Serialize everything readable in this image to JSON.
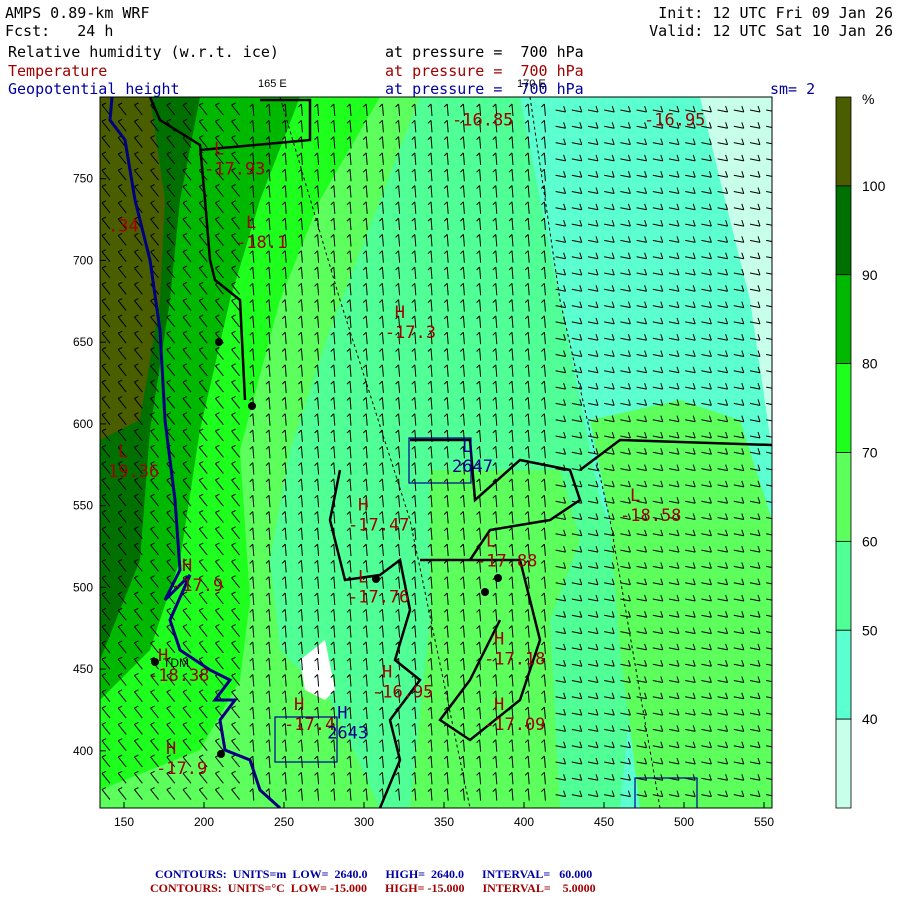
{
  "header": {
    "model": "AMPS 0.89-km WRF",
    "forecast": "Fcst:   24 h",
    "init": "Init: 12 UTC Fri 09 Jan 26",
    "valid": "Valid: 12 UTC Sat 10 Jan 26",
    "fields": [
      {
        "name": "Relative humidity (w.r.t. ice)",
        "level": "at pressure =  700 hPa"
      },
      {
        "name": "Temperature",
        "level": "at pressure =  700 hPa"
      },
      {
        "name": "Geopotential height",
        "level": "at pressure =  700 hPa"
      }
    ],
    "smoothing": "sm= 2",
    "lon_labels": [
      "165 E",
      "170 E"
    ]
  },
  "colors": {
    "temperature": "#a00000",
    "height": "#000090",
    "coast": "#000000",
    "river": "#000080"
  },
  "chart_data": {
    "type": "heatmap",
    "title": "Relative humidity (w.r.t. ice) at 700 hPa",
    "x_ticks": [
      "150",
      "200",
      "250",
      "300",
      "350",
      "400",
      "450",
      "500",
      "550"
    ],
    "y_ticks": [
      "750",
      "700",
      "650",
      "600",
      "550",
      "500",
      "450",
      "400"
    ],
    "xlim": [
      135,
      555
    ],
    "ylim": [
      365,
      800
    ],
    "colorbar": {
      "unit": "%",
      "levels": [
        "40",
        "50",
        "60",
        "70",
        "80",
        "90",
        "100"
      ],
      "colors": [
        "#c8ffea",
        "#5cffd0",
        "#50ff96",
        "#5cff5c",
        "#1eff1e",
        "#00b800",
        "#007000",
        "#4a5e00"
      ]
    },
    "temperature_labels": [
      {
        "mark": "",
        "value": "-16.85",
        "x": 355,
        "y": 790
      },
      {
        "mark": "",
        "value": "-16.95",
        "x": 475,
        "y": 790
      },
      {
        "mark": "L",
        "value": "-17.93",
        "x": 200,
        "y": 760
      },
      {
        "mark": "",
        "value": ".34",
        "x": 140,
        "y": 725
      },
      {
        "mark": "L",
        "value": "-18.1",
        "x": 220,
        "y": 715
      },
      {
        "mark": "H",
        "value": "-17.3",
        "x": 313,
        "y": 660
      },
      {
        "mark": "L",
        "value": "19.36",
        "x": 140,
        "y": 575
      },
      {
        "mark": "H",
        "value": "-17.47",
        "x": 290,
        "y": 542
      },
      {
        "mark": "L",
        "value": "-18.58",
        "x": 460,
        "y": 548
      },
      {
        "mark": "L",
        "value": "-17.88",
        "x": 370,
        "y": 520
      },
      {
        "mark": "H",
        "value": "-17.9",
        "x": 180,
        "y": 505
      },
      {
        "mark": "L",
        "value": "-17.76",
        "x": 290,
        "y": 498
      },
      {
        "mark": "H",
        "value": "-17.18",
        "x": 375,
        "y": 460
      },
      {
        "mark": "H",
        "value": "-18.38",
        "x": 165,
        "y": 450
      },
      {
        "mark": "H",
        "value": "-16.95",
        "x": 305,
        "y": 440
      },
      {
        "mark": "H",
        "value": "-17.4",
        "x": 250,
        "y": 420
      },
      {
        "mark": "H",
        "value": "-17.09",
        "x": 375,
        "y": 420
      },
      {
        "mark": "H",
        "value": "-17.9",
        "x": 170,
        "y": 393
      }
    ],
    "height_labels": [
      {
        "mark": "L",
        "value": "2647",
        "x": 355,
        "y": 578
      },
      {
        "mark": "H",
        "value": "2643",
        "x": 277,
        "y": 415
      }
    ],
    "station": "TDM"
  },
  "footer": {
    "height_contours": {
      "label": "CONTOURS:",
      "units": "UNITS=m",
      "low": "LOW=  2640.0",
      "high": "HIGH=  2640.0",
      "interval": "INTERVAL=   60.000"
    },
    "temp_contours": {
      "label": "CONTOURS:",
      "units": "UNITS=°C",
      "low": "LOW= -15.000",
      "high": "HIGH= -15.000",
      "interval": "INTERVAL=    5.0000"
    }
  }
}
